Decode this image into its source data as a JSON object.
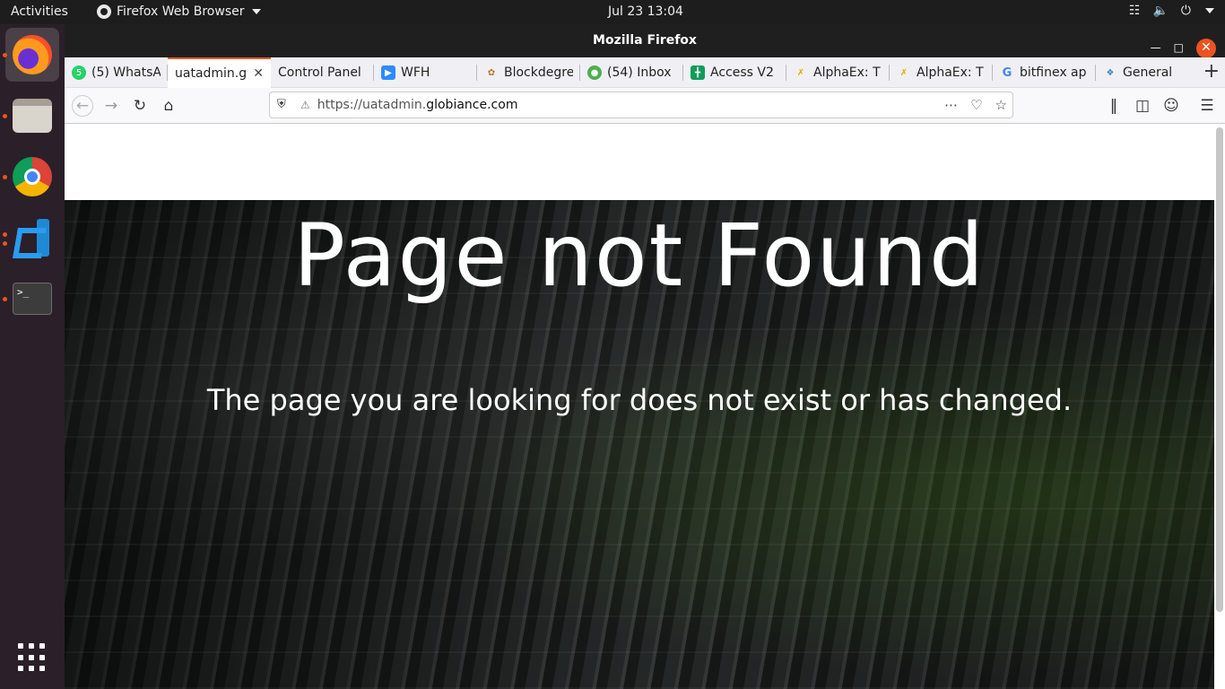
{
  "topbar": {
    "activities": "Activities",
    "app_menu": "Firefox Web Browser",
    "clock": "Jul 23  13:04"
  },
  "window": {
    "title": "Mozilla Firefox"
  },
  "tabs": [
    {
      "title": "(5) WhatsA",
      "icon": "whatsapp-icon",
      "color": "#25d366"
    },
    {
      "title": "uatadmin.g",
      "icon": "blank-page-icon",
      "color": "#ffffff",
      "selected": true
    },
    {
      "title": "Control Panel",
      "icon": "none",
      "color": ""
    },
    {
      "title": "WFH",
      "icon": "zoom-icon",
      "color": "#2d8cff"
    },
    {
      "title": "Blockdegre",
      "icon": "blockdegree-icon",
      "color": "#c0702a"
    },
    {
      "title": "(54) Inbox",
      "icon": "inbox-icon",
      "color": "#4caf50"
    },
    {
      "title": "Access V2",
      "icon": "sheets-icon",
      "color": "#0f9d58"
    },
    {
      "title": "AlphaEx: T",
      "icon": "alphaex-icon",
      "color": "#e0a800"
    },
    {
      "title": "AlphaEx: T",
      "icon": "alphaex-icon",
      "color": "#e0a800"
    },
    {
      "title": "bitfinex ap",
      "icon": "google-icon",
      "color": "#4285f4"
    },
    {
      "title": "General",
      "icon": "leaf-icon",
      "color": "#3b82c4"
    }
  ],
  "url": {
    "prefix": "https://uatadmin.",
    "domain": "globiance.com"
  },
  "page": {
    "heading": "Page not Found",
    "message": "The page you are looking for does not exist or has changed."
  },
  "colors": {
    "accent": "#e95420",
    "tab_highlight": "#e55d25"
  }
}
